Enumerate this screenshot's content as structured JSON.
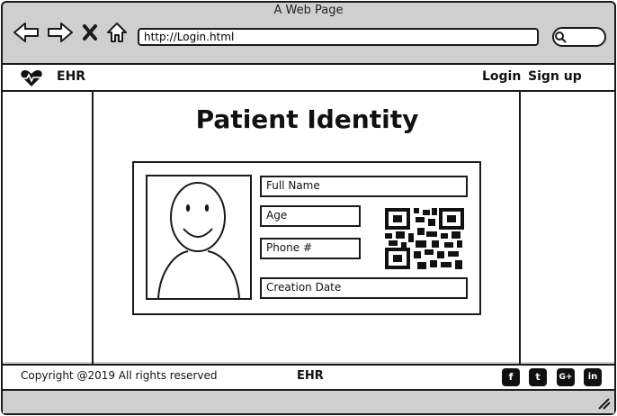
{
  "browser": {
    "window_title": "A Web Page",
    "url": "http://Login.html"
  },
  "header": {
    "brand": "EHR",
    "links": {
      "login": "Login",
      "signup": "Sign up"
    }
  },
  "main": {
    "title": "Patient Identity",
    "fields": {
      "full_name": "Full Name",
      "age": "Age",
      "phone": "Phone #",
      "creation_date": "Creation Date"
    }
  },
  "footer": {
    "copyright": "Copyright @2019 All rights reserved",
    "brand": "EHR",
    "social": {
      "facebook": "f",
      "twitter": "t",
      "googleplus": "G+",
      "linkedin": "in"
    }
  },
  "icons": {
    "back": "arrow-left-icon",
    "forward": "arrow-right-icon",
    "stop": "close-icon",
    "home": "home-icon",
    "search": "search-icon",
    "logo": "heart-pulse-icon",
    "qr": "qr-code-icon"
  }
}
